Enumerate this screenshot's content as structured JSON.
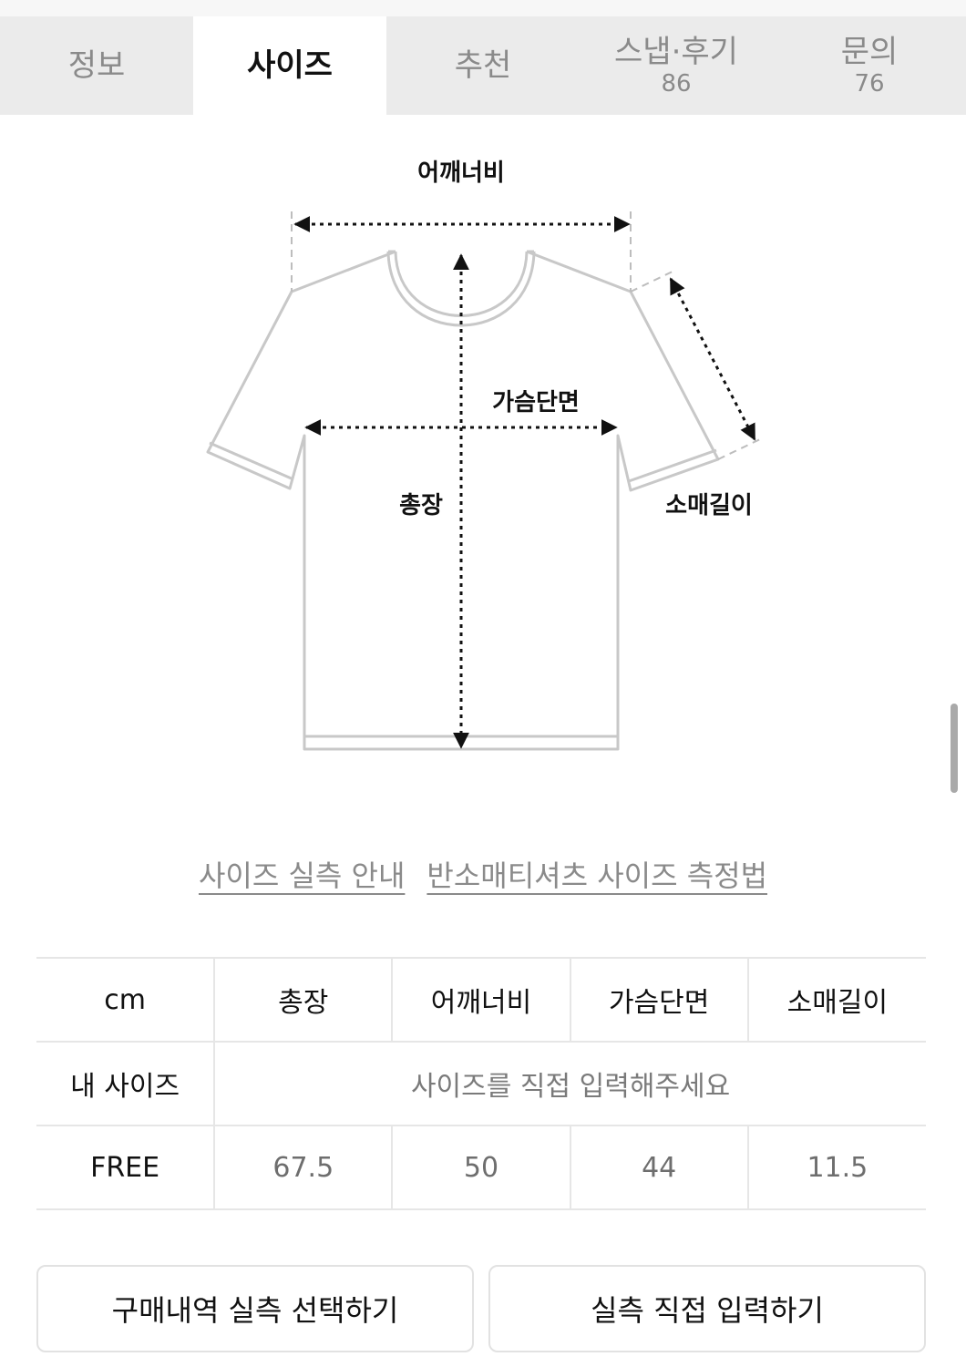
{
  "tabs": [
    {
      "label": "정보",
      "count": ""
    },
    {
      "label": "사이즈",
      "count": "",
      "active": true
    },
    {
      "label": "추천",
      "count": ""
    },
    {
      "label": "스냅·후기",
      "count": "86"
    },
    {
      "label": "문의",
      "count": "76"
    }
  ],
  "diagram": {
    "shoulder_width": "어깨너비",
    "chest_width": "가슴단면",
    "total_length": "총장",
    "sleeve_length": "소매길이"
  },
  "links": {
    "guide": "사이즈 실측 안내",
    "method": "반소매티셔츠 사이즈 측정법"
  },
  "table": {
    "unit": "cm",
    "headers": [
      "총장",
      "어깨너비",
      "가슴단면",
      "소매길이"
    ],
    "my_size_label": "내 사이즈",
    "my_size_prompt": "사이즈를 직접 입력해주세요",
    "rows": [
      {
        "size": "FREE",
        "values": [
          "67.5",
          "50",
          "44",
          "11.5"
        ]
      }
    ]
  },
  "buttons": {
    "select_history": "구매내역 실측 선택하기",
    "manual_input": "실측 직접 입력하기"
  }
}
